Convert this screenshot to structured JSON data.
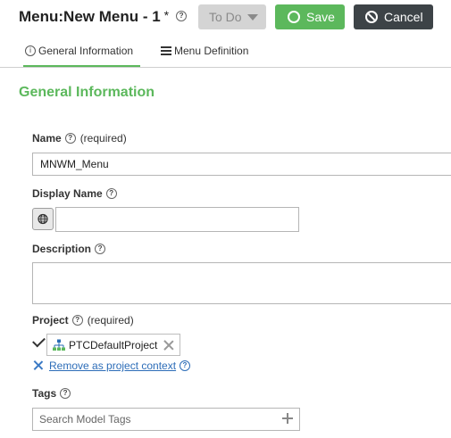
{
  "header": {
    "label": "Menu:",
    "name": "New Menu - 1",
    "dirty_marker": "*",
    "help": "?",
    "state_label": "To Do",
    "save_label": "Save",
    "cancel_label": "Cancel"
  },
  "tabs": [
    {
      "label": "General Information",
      "icon": "info-icon",
      "active": true
    },
    {
      "label": "Menu Definition",
      "icon": "list-icon",
      "active": false
    }
  ],
  "section_title": "General Information",
  "fields": {
    "name": {
      "label": "Name",
      "required": "(required)",
      "value": "MNWM_Menu"
    },
    "display_name": {
      "label": "Display Name",
      "value": "",
      "icon": "globe-icon"
    },
    "description": {
      "label": "Description",
      "value": ""
    },
    "project": {
      "label": "Project",
      "required": "(required)",
      "value": "PTCDefaultProject",
      "icon": "hierarchy-icon",
      "remove_link": "Remove as project context"
    },
    "tags": {
      "label": "Tags",
      "placeholder": "Search Model Tags"
    }
  },
  "colors": {
    "accent_green": "#5cb85c",
    "cancel_dark": "#3d4347",
    "disabled_gray": "#d4d4d4",
    "link_blue": "#2d6db8"
  }
}
